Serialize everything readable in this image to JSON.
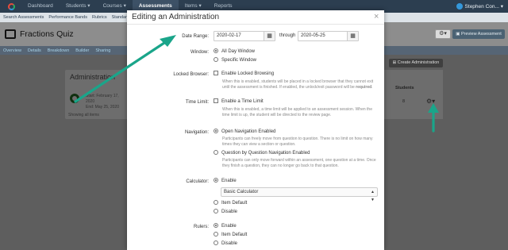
{
  "nav": {
    "items": [
      "Dashboard",
      "Students",
      "Courses",
      "Assessments",
      "Items",
      "Reports"
    ],
    "user": "Stephen Con..."
  },
  "subnav": [
    "Search Assessments",
    "Performance Bands",
    "Rubrics",
    "Standards"
  ],
  "page": {
    "title": "Fractions Quiz",
    "preview_button": "Preview Assessment",
    "tabs": [
      "Overview",
      "Details",
      "Breakdown",
      "Builder",
      "Sharing"
    ],
    "create_button": "Create Administration",
    "admin_panel_title": "Administration",
    "admin_start": "Start: February 17, 2020",
    "admin_end": "End: May 25, 2020",
    "admin_footer": "Showing all items",
    "students_header": "Students",
    "students_value": "8"
  },
  "modal": {
    "title": "Editing an Administration",
    "date_range_label": "Date Range:",
    "date_start": "2020-02-17",
    "through": "through",
    "date_end": "2020-05-25",
    "window_label": "Window:",
    "window_all_day": "All Day Window",
    "window_specific": "Specific Window",
    "locked_label": "Locked Browser:",
    "locked_option": "Enable Locked Browsing",
    "locked_help_1": "When this is enabled, students will be placed in a locked browser that they cannot exit",
    "locked_help_2": "until the assessment is finished. If enabled, the unlock/exit password will be ",
    "locked_help_required": "required",
    "time_label": "Time Limit:",
    "time_option": "Enable a Time Limit",
    "time_help": "When this is enabled, a time limit will be applied to an assessment session. When the time limit is up, the student will be directed to the review page.",
    "nav_label": "Navigation:",
    "nav_open": "Open Navigation Enabled",
    "nav_open_help": "Participants can freely move from question to question. There is no limit on how many times they can view a section or question.",
    "nav_qbq": "Question by Question Navigation Enabled",
    "nav_qbq_help": "Participants can only move forward within an assessment, one question at a time. Once they finish a question, they can no longer go back to that question.",
    "calc_label": "Calculator:",
    "calc_enable": "Enable",
    "calc_select": "Basic Calculator",
    "calc_item_default": "Item Default",
    "calc_disable": "Disable",
    "rulers_label": "Rulers:",
    "rulers_enable": "Enable",
    "rulers_item_default": "Item Default",
    "rulers_disable": "Disable"
  },
  "colors": {
    "annotation_arrow": "#1aa58a",
    "nav_bg": "#2c3e50"
  }
}
